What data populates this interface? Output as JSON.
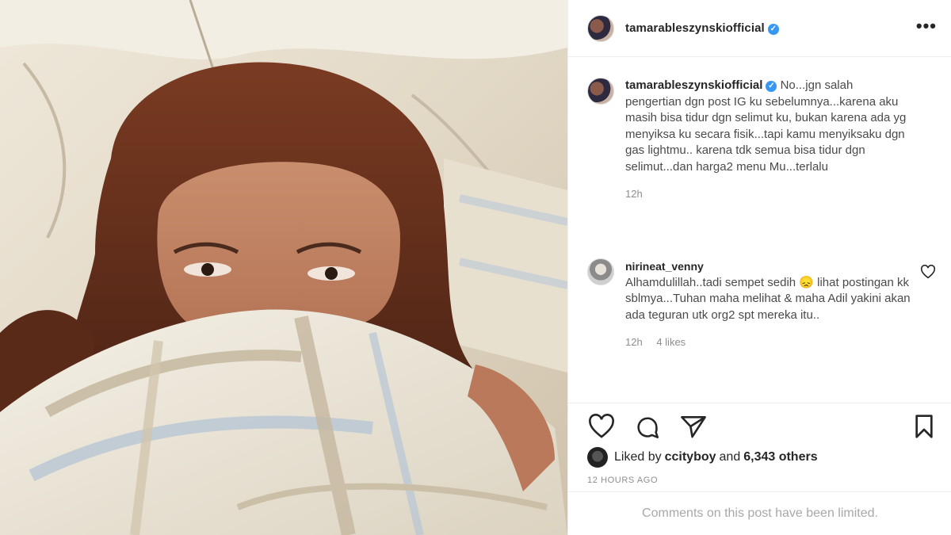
{
  "post": {
    "username": "tamarableszynskiofficial",
    "verified_mark": "✓",
    "more_icon": "more-horizontal-icon",
    "more_label": "•••"
  },
  "comments": [
    {
      "username": "tamarableszynskiofficial",
      "text": "No...jgn salah pengertian dgn post IG ku sebelumnya...karena aku masih bisa tidur dgn selimut ku, bukan karena ada yg menyiksa ku secara fisik...tapi kamu menyiksaku dgn gas lightmu.. karena tdk semua bisa tidur dgn selimut...dan harga2 menu Mu...terlalu",
      "time": "12h"
    },
    {
      "username": "nirineat_venny",
      "text": "Alhamdulillah..tadi sempet sedih 😞 lihat postingan kk sblmya...Tuhan maha melihat & maha Adil yakini akan ada teguran utk org2 spt mereka itu..",
      "time": "12h",
      "likes": "4 likes"
    }
  ],
  "likes": {
    "prefix": "Liked by",
    "user": "ccityboy",
    "joiner": "and",
    "others": "6,343 others"
  },
  "timestamp": "12 HOURS AGO",
  "limited_notice": "Comments on this post have been limited.",
  "icons": [
    "heart-icon",
    "comment-icon",
    "share-icon",
    "bookmark-icon"
  ],
  "colors": {
    "verified": "#3897f0",
    "text": "#262626",
    "muted": "#8e8e8e"
  }
}
